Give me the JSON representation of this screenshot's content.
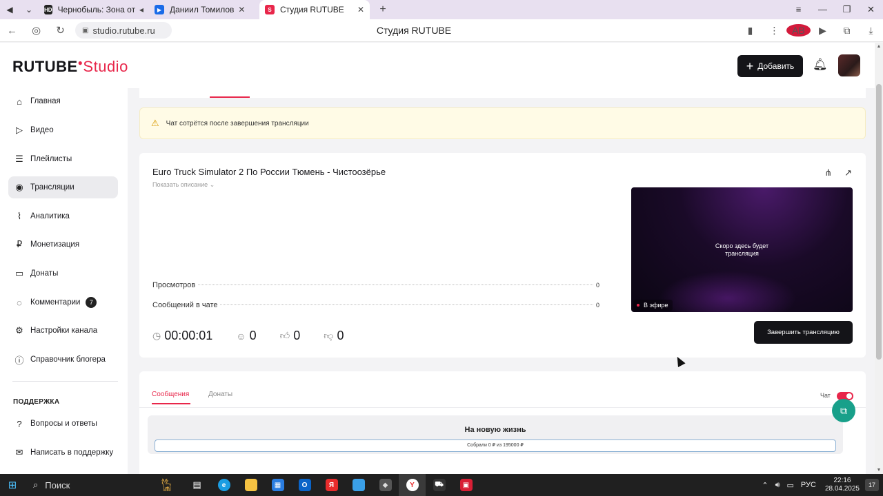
{
  "browser": {
    "tabs": [
      {
        "favicon": "HD",
        "favicon_color": "#222222",
        "label": "Чернобыль: Зона отчужд",
        "extra_icon": "speaker-icon"
      },
      {
        "favicon": "▶",
        "favicon_color": "#1a6be8",
        "label": "Даниил Томилов"
      },
      {
        "favicon": "S",
        "favicon_color": "#e8264a",
        "label": "Студия RUTUBE",
        "active": true
      }
    ],
    "url": "studio.rutube.ru",
    "page_title": "Студия RUTUBE",
    "extension_badge": "AB"
  },
  "header": {
    "logo_main": "RUTUBE",
    "logo_studio": "Studio",
    "add_button": "Добавить"
  },
  "sidebar": {
    "items": [
      {
        "label": "Главная",
        "icon": "home-icon",
        "glyph": "⌂"
      },
      {
        "label": "Видео",
        "icon": "video-icon",
        "glyph": "▷"
      },
      {
        "label": "Плейлисты",
        "icon": "playlist-icon",
        "glyph": "☰"
      },
      {
        "label": "Трансляции",
        "icon": "broadcast-icon",
        "glyph": "◉",
        "active": true
      },
      {
        "label": "Аналитика",
        "icon": "analytics-icon",
        "glyph": "⌇"
      },
      {
        "label": "Монетизация",
        "icon": "monetization-icon",
        "glyph": "₽"
      },
      {
        "label": "Донаты",
        "icon": "donate-icon",
        "glyph": "▭"
      },
      {
        "label": "Комментарии",
        "icon": "comments-icon",
        "glyph": "◌",
        "count": "7"
      },
      {
        "label": "Настройки канала",
        "icon": "settings-icon",
        "glyph": "⚙"
      },
      {
        "label": "Справочник блогера",
        "icon": "info-icon",
        "glyph": "ⓘ"
      }
    ],
    "support_title": "ПОДДЕРЖКА",
    "support_items": [
      {
        "label": "Вопросы и ответы",
        "icon": "faq-icon",
        "glyph": "?"
      },
      {
        "label": "Написать в поддержку",
        "icon": "mail-icon",
        "glyph": "✉"
      }
    ]
  },
  "alert": {
    "text": "Чат сотрётся после завершения трансляции"
  },
  "stream": {
    "title": "Euro Truck Simulator 2 По России Тюмень - Чистоозёрье",
    "show_description": "Показать описание",
    "stats": [
      {
        "label": "Просмотров",
        "value": "0"
      },
      {
        "label": "Сообщений в чате",
        "value": "0"
      }
    ],
    "preview_text": "Скоро здесь будет\nтрансляция",
    "live_badge": "В эфире",
    "timer": "00:00:01",
    "viewers": "0",
    "likes": "0",
    "dislikes": "0",
    "end_button": "Завершить трансляцию"
  },
  "chat": {
    "tabs": [
      "Сообщения",
      "Донаты"
    ],
    "toggle_label": "Чат",
    "toggle_on": true,
    "goal_title": "На новую жизнь",
    "goal_progress": "Собрали 0 ₽  из 195000 ₽"
  },
  "taskbar": {
    "search": "Поиск",
    "lang": "РУС",
    "time": "22:16",
    "date": "28.04.2025",
    "notifications": "17"
  },
  "colors": {
    "accent": "#e8264a",
    "dark": "#141418"
  }
}
